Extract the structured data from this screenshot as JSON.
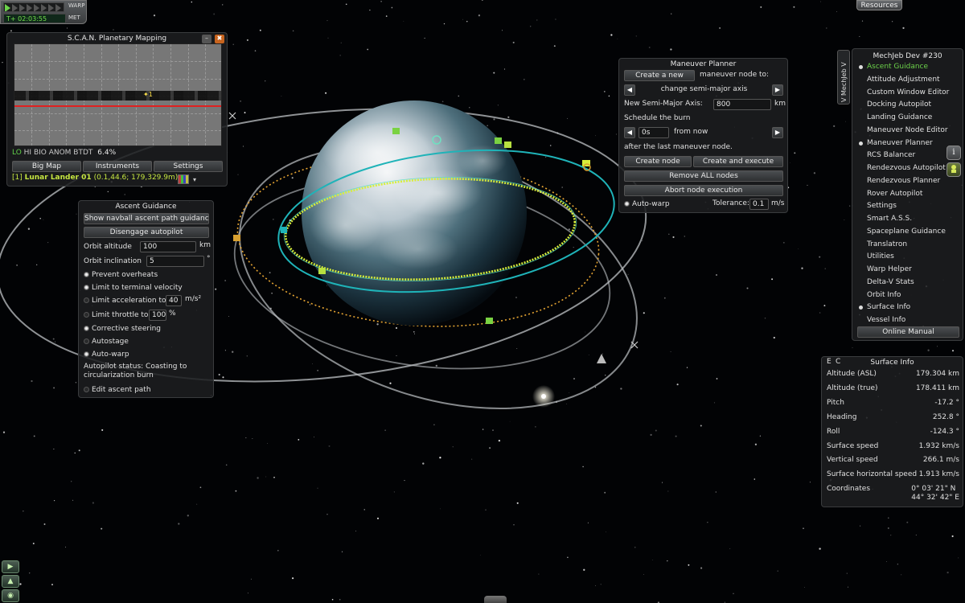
{
  "time": {
    "warp_label": "WARP",
    "met_label": "MET",
    "met": "T+ 02:03:55",
    "warp_level": 1
  },
  "resources": {
    "label": "Resources"
  },
  "scan": {
    "title": "S.C.A.N. Planetary Mapping",
    "minimize": "–",
    "close": "✖",
    "legend_lo": "LO",
    "legend_rest": "HI BIO ANOM BTDT",
    "legend_pct": "6.4%",
    "buttons": [
      "Big Map",
      "Instruments",
      "Settings"
    ],
    "vessel_index": "[1]",
    "vessel_name": "Lunar Lander 01",
    "vessel_coords": "(0.1,44.6; 179,329.9m)",
    "map_marker": "1"
  },
  "ascent": {
    "title": "Ascent Guidance",
    "btn_navball": "Show navball ascent path guidance",
    "btn_autopilot": "Disengage autopilot",
    "orbit_alt_label": "Orbit altitude",
    "orbit_alt_value": "100",
    "orbit_alt_unit": "km",
    "orbit_inc_label": "Orbit inclination",
    "orbit_inc_value": "5",
    "orbit_inc_unit": "°",
    "prevent_overheats": "Prevent overheats",
    "limit_terminal": "Limit to terminal velocity",
    "limit_accel_label": "Limit acceleration to",
    "limit_accel_value": "40",
    "limit_accel_unit": "m/s²",
    "limit_throttle_label": "Limit throttle to",
    "limit_throttle_value": "100",
    "limit_throttle_unit": "%",
    "corrective": "Corrective steering",
    "autostage": "Autostage",
    "autowarp": "Auto-warp",
    "status_line1": "Autopilot status: Coasting to",
    "status_line2": "circularization burn",
    "edit_path": "Edit ascent path"
  },
  "maneuver": {
    "title": "Maneuver Planner",
    "create_new": "Create a new",
    "node_to": "maneuver node to:",
    "operation": "change semi-major axis",
    "sma_label": "New Semi-Major Axis:",
    "sma_value": "800",
    "sma_unit": "km",
    "schedule": "Schedule the burn",
    "time_value": "0s",
    "from_now": "from now",
    "after_last": "after the last maneuver node.",
    "create_node": "Create node",
    "create_execute": "Create and execute",
    "remove_all": "Remove ALL nodes",
    "abort": "Abort node execution",
    "autowarp": "Auto-warp",
    "tolerance_label": "Tolerance:",
    "tolerance_value": "0.1",
    "tolerance_unit": "m/s",
    "prev_arrow": "◀",
    "next_arrow": "▶"
  },
  "mechjeb": {
    "tab_label": "V MechJeb V",
    "title": "MechJeb Dev #230",
    "items": [
      {
        "label": "Ascent Guidance",
        "on": true,
        "active": true
      },
      {
        "label": "Attitude Adjustment",
        "on": false
      },
      {
        "label": "Custom Window Editor",
        "on": false
      },
      {
        "label": "Docking Autopilot",
        "on": false
      },
      {
        "label": "Landing Guidance",
        "on": false
      },
      {
        "label": "Maneuver Node Editor",
        "on": false
      },
      {
        "label": "Maneuver Planner",
        "on": true
      },
      {
        "label": "RCS Balancer",
        "on": false
      },
      {
        "label": "Rendezvous Autopilot",
        "on": false
      },
      {
        "label": "Rendezvous Planner",
        "on": false
      },
      {
        "label": "Rover Autopilot",
        "on": false
      },
      {
        "label": "Settings",
        "on": false
      },
      {
        "label": "Smart A.S.S.",
        "on": false
      },
      {
        "label": "Spaceplane Guidance",
        "on": false
      },
      {
        "label": "Translatron",
        "on": false
      },
      {
        "label": "Utilities",
        "on": false
      },
      {
        "label": "Warp Helper",
        "on": false
      },
      {
        "label": "Delta-V Stats",
        "on": false
      },
      {
        "label": "Orbit Info",
        "on": false
      },
      {
        "label": "Surface Info",
        "on": true
      },
      {
        "label": "Vessel Info",
        "on": false
      }
    ],
    "manual": "Online Manual"
  },
  "surface": {
    "tab_e": "E",
    "tab_c": "C",
    "title": "Surface Info",
    "rows": [
      {
        "label": "Altitude (ASL)",
        "value": "179.304 km"
      },
      {
        "label": "Altitude (true)",
        "value": "178.411 km"
      },
      {
        "label": "Pitch",
        "value": "-17.2 °"
      },
      {
        "label": "Heading",
        "value": "252.8 °"
      },
      {
        "label": "Roll",
        "value": "-124.3 °"
      },
      {
        "label": "Surface speed",
        "value": "1.932 km/s"
      },
      {
        "label": "Vertical speed",
        "value": "266.1 m/s"
      },
      {
        "label": "Surface horizontal speed",
        "value": "1.913 km/s"
      }
    ],
    "coords_label": "Coordinates",
    "coords_lat": "0° 03' 21\" N",
    "coords_lon": "44° 32' 42\" E"
  },
  "side": {
    "info": "i"
  },
  "colors": {
    "active_green": "#6cd24a",
    "vessel_yellow": "#c6e640",
    "orbit_cyan": "#1fb3b8",
    "orbit_yellow": "#e0e83a",
    "orbit_orange": "#e6a532"
  }
}
